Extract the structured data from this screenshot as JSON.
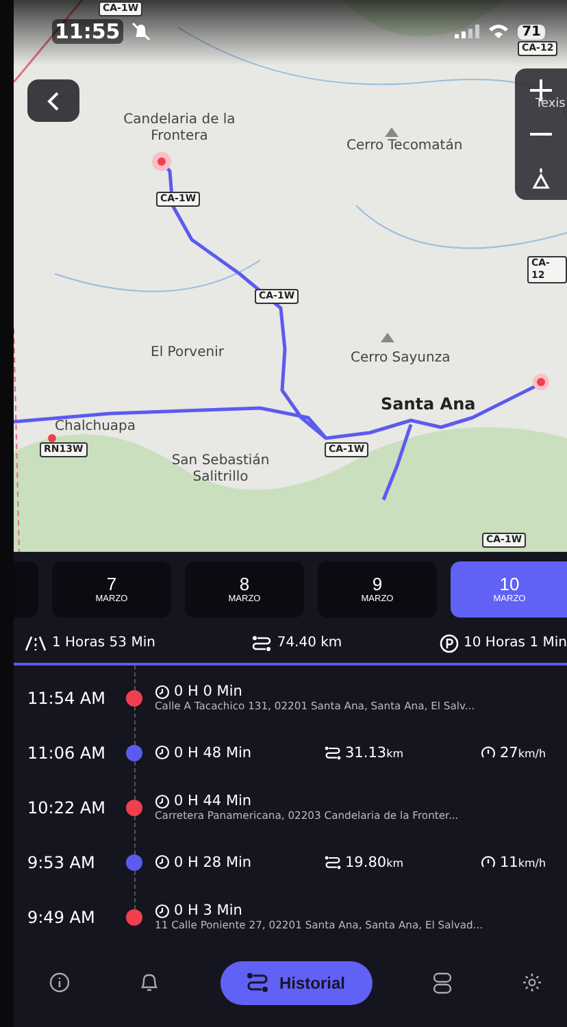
{
  "status_bar": {
    "time": "11:55",
    "battery": "71"
  },
  "map": {
    "labels": [
      {
        "kind": "road",
        "text": "CA-1W"
      },
      {
        "kind": "road",
        "text": "CA-12"
      },
      {
        "kind": "place",
        "text": "Candelaria de la Frontera"
      },
      {
        "kind": "place",
        "text": "Texis"
      },
      {
        "kind": "peak",
        "text": "Cerro Tecomatán"
      },
      {
        "kind": "road",
        "text": "CA-1W"
      },
      {
        "kind": "road",
        "text": "CA-12"
      },
      {
        "kind": "road",
        "text": "CA-1W"
      },
      {
        "kind": "place",
        "text": "El Porvenir"
      },
      {
        "kind": "peak",
        "text": "Cerro Sayunza"
      },
      {
        "kind": "city",
        "text": "Santa Ana"
      },
      {
        "kind": "place",
        "text": "Chalchuapa"
      },
      {
        "kind": "road",
        "text": "RN13W"
      },
      {
        "kind": "road",
        "text": "CA-1W"
      },
      {
        "kind": "place",
        "text": "San Sebastián Salitrillo"
      },
      {
        "kind": "road",
        "text": "CA-1W"
      }
    ]
  },
  "dates": [
    {
      "selected": false
    },
    {
      "day": "7",
      "month": "MARZO",
      "selected": false
    },
    {
      "day": "8",
      "month": "MARZO",
      "selected": false
    },
    {
      "day": "9",
      "month": "MARZO",
      "selected": false
    },
    {
      "day": "10",
      "month": "MARZO",
      "selected": true
    }
  ],
  "summary": [
    {
      "kind": "drive",
      "text": "1 Horas 53 Min"
    },
    {
      "kind": "distance",
      "text": "74.40 km"
    },
    {
      "kind": "parked",
      "text": "10 Horas 1 Min"
    }
  ],
  "entries": [
    {
      "kind": "stop",
      "time": "11:54 AM",
      "duration": "0 H 0 Min",
      "address": "Calle A Tacachico 131, 02201 Santa Ana, Santa Ana, El Salv..."
    },
    {
      "kind": "trip",
      "time": "11:06 AM",
      "duration": "0 H 48 Min",
      "distance": "31.13",
      "distance_unit": "km",
      "speed": "27",
      "speed_unit": "km/h"
    },
    {
      "kind": "stop",
      "time": "10:22 AM",
      "duration": "0 H 44 Min",
      "address": "Carretera Panamericana, 02203 Candelaria de la Fronter..."
    },
    {
      "kind": "trip",
      "time": "9:53 AM",
      "duration": "0 H 28 Min",
      "distance": "19.80",
      "distance_unit": "km",
      "speed": "11",
      "speed_unit": "km/h"
    },
    {
      "kind": "stop",
      "time": "9:49 AM",
      "duration": "0 H 3 Min",
      "address": "11 Calle Poniente 27, 02201 Santa Ana, Santa Ana, El Salvad..."
    }
  ],
  "nav": [
    {
      "kind": "info",
      "selected": false
    },
    {
      "kind": "bell",
      "selected": false
    },
    {
      "kind": "history",
      "label": "Historial",
      "selected": true
    },
    {
      "kind": "toggles",
      "selected": false
    },
    {
      "kind": "gear",
      "selected": false
    }
  ]
}
